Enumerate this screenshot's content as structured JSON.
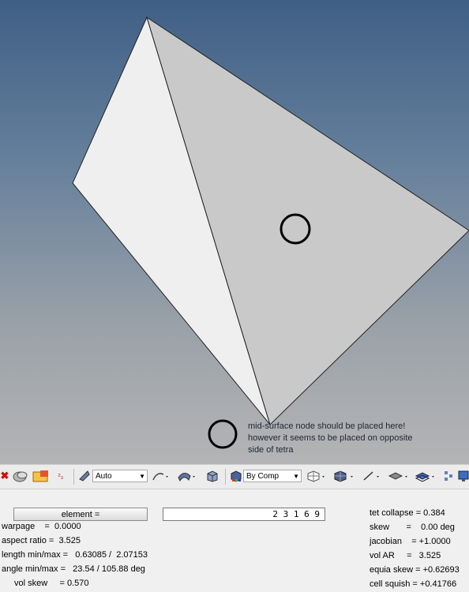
{
  "note": {
    "line1": "mid-surface node should be placed here!",
    "line2": "however it seems to be placed on opposite",
    "line3": "side of tetra"
  },
  "toolbar": {
    "auto_label": "Auto",
    "bycomp_label": "By Comp",
    "icons": [
      "close-icon",
      "mask-icon",
      "folder-icon",
      "numbering-icon",
      "visualization-icon",
      "line-style-icon",
      "surface-style-icon",
      "solid-view-icon",
      "color-mode-icon",
      "mesh-icon",
      "shaded-element-icon",
      "line-icon",
      "plane-icon",
      "layer-icon",
      "tree-icon",
      "monitor-icon"
    ]
  },
  "panel": {
    "element_button": "element =",
    "element_value": "2  3  1  6  9",
    "left": {
      "warpage": "warpage    =  0.0000",
      "aspect": "aspect ratio =  3.525",
      "length": "length min/max =   0.63085 /  2.07153",
      "angle": "angle min/max =   23.54 / 105.88 deg",
      "vol_skew": "vol skew     = 0.570"
    },
    "right": {
      "tet_collapse": "tet collapse = 0.384",
      "skew": "skew       =    0.00 deg",
      "jacobian": "jacobian    = +1.0000",
      "vol_ar": "vol AR     =   3.525",
      "equia_skew": "equia skew = +0.62693",
      "cell_squish": "cell squish = +0.41766"
    }
  },
  "colors": {
    "face_left": "#efefef",
    "face_right": "#c9c9c9",
    "bg_top": "#3f5f85",
    "bg_bottom": "#b4b4b6"
  }
}
